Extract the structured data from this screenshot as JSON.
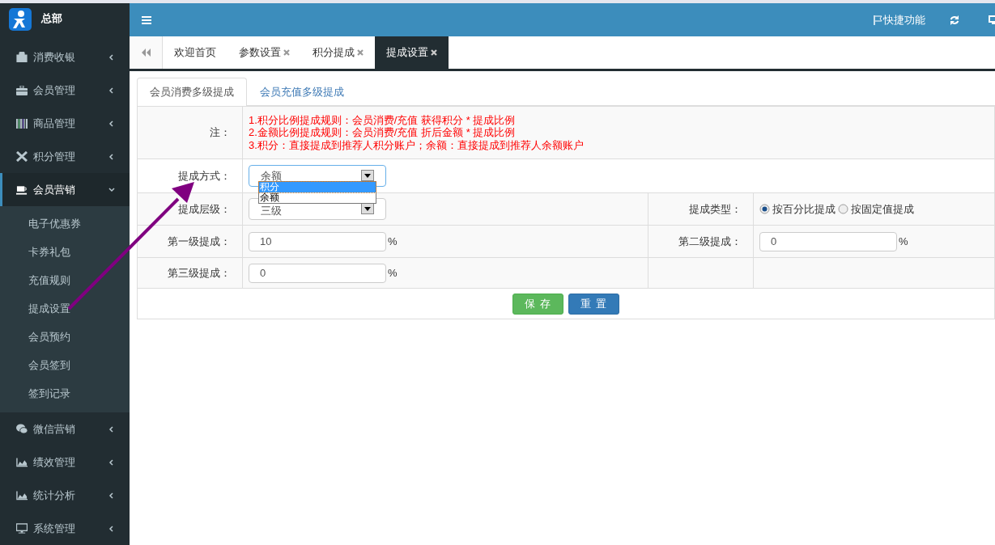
{
  "sidebar": {
    "title": "总部",
    "items": [
      {
        "label": "消费收银",
        "expanded": false
      },
      {
        "label": "会员管理",
        "expanded": false
      },
      {
        "label": "商品管理",
        "expanded": false
      },
      {
        "label": "积分管理",
        "expanded": false
      },
      {
        "label": "会员营销",
        "expanded": true,
        "children": [
          {
            "label": "电子优惠券"
          },
          {
            "label": "卡券礼包"
          },
          {
            "label": "充值规则"
          },
          {
            "label": "提成设置"
          },
          {
            "label": "会员预约"
          },
          {
            "label": "会员签到"
          },
          {
            "label": "签到记录"
          }
        ]
      },
      {
        "label": "微信营销",
        "expanded": false
      },
      {
        "label": "绩效管理",
        "expanded": false
      },
      {
        "label": "统计分析",
        "expanded": false
      },
      {
        "label": "系统管理",
        "expanded": false
      }
    ]
  },
  "topbar": {
    "shortcut": "快捷功能"
  },
  "page_tabs": [
    {
      "label": "欢迎首页",
      "closable": false,
      "selected": false
    },
    {
      "label": "参数设置",
      "closable": true,
      "selected": false
    },
    {
      "label": "积分提成",
      "closable": true,
      "selected": false
    },
    {
      "label": "提成设置",
      "closable": true,
      "selected": true
    }
  ],
  "sub_tabs": [
    {
      "label": "会员消费多级提成",
      "selected": true
    },
    {
      "label": "会员充值多级提成",
      "selected": false
    }
  ],
  "notes": {
    "label": "注：",
    "lines": [
      "1.积分比例提成规则：会员消费/充值 获得积分 * 提成比例",
      "2.金额比例提成规则：会员消费/充值 折后金额 * 提成比例",
      "3.积分：直接提成到推荐人积分账户；余额：直接提成到推荐人余额账户"
    ]
  },
  "commission_mode": {
    "label": "提成方式：",
    "value": "余额",
    "open": true,
    "options": [
      {
        "label": "积分",
        "highlighted": true
      },
      {
        "label": "余额",
        "highlighted": false
      }
    ]
  },
  "commission_level": {
    "label": "提成层级：",
    "value": "三级"
  },
  "commission_type": {
    "label": "提成类型：",
    "options": [
      {
        "label": "按百分比提成",
        "selected": true
      },
      {
        "label": "按固定值提成",
        "selected": false
      }
    ]
  },
  "levels": [
    {
      "label": "第一级提成：",
      "value": "10",
      "unit": "%"
    },
    {
      "label": "第二级提成：",
      "value": "0",
      "unit": "%"
    },
    {
      "label": "第三级提成：",
      "value": "0",
      "unit": "%"
    }
  ],
  "buttons": [
    {
      "label": "保 存",
      "kind": "success"
    },
    {
      "label": "重 置",
      "kind": "primary"
    }
  ]
}
